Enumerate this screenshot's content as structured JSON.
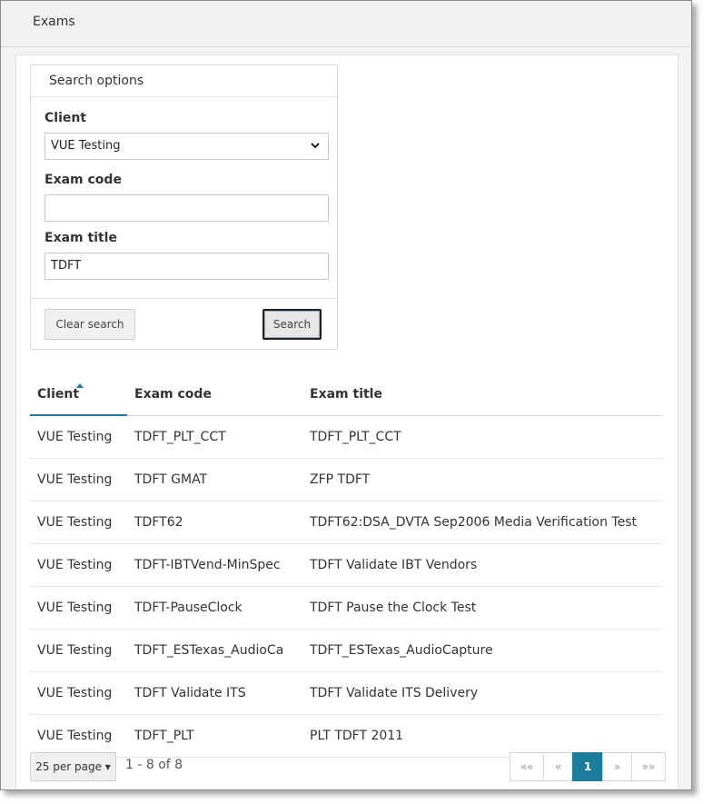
{
  "header": {
    "title": "Exams"
  },
  "search": {
    "heading": "Search options",
    "client_label": "Client",
    "client_value": "VUE Testing",
    "exam_code_label": "Exam code",
    "exam_code_value": "",
    "exam_title_label": "Exam title",
    "exam_title_value": "TDFT",
    "clear_button": "Clear search",
    "search_button": "Search"
  },
  "table": {
    "columns": [
      "Client",
      "Exam code",
      "Exam title"
    ],
    "sorted_column": "Client",
    "rows": [
      [
        "VUE Testing",
        "TDFT_PLT_CCT",
        "TDFT_PLT_CCT"
      ],
      [
        "VUE Testing",
        "TDFT GMAT",
        "ZFP TDFT"
      ],
      [
        "VUE Testing",
        "TDFT62",
        "TDFT62:DSA_DVTA Sep2006 Media Verification Test"
      ],
      [
        "VUE Testing",
        "TDFT-IBTVend-MinSpec",
        "TDFT Validate IBT Vendors"
      ],
      [
        "VUE Testing",
        "TDFT-PauseClock",
        "TDFT Pause the Clock Test"
      ],
      [
        "VUE Testing",
        "TDFT_ESTexas_AudioCa",
        "TDFT_ESTexas_AudioCapture"
      ],
      [
        "VUE Testing",
        "TDFT Validate ITS",
        "TDFT Validate ITS Delivery"
      ],
      [
        "VUE Testing",
        "TDFT_PLT",
        "PLT TDFT 2011"
      ]
    ]
  },
  "pagination": {
    "per_page": "25 per page",
    "range": "1 - 8 of 8",
    "first": "««",
    "prev": "«",
    "current": "1",
    "next": "»",
    "last": "»»"
  },
  "colors": {
    "accent": "#1b7c9c"
  }
}
